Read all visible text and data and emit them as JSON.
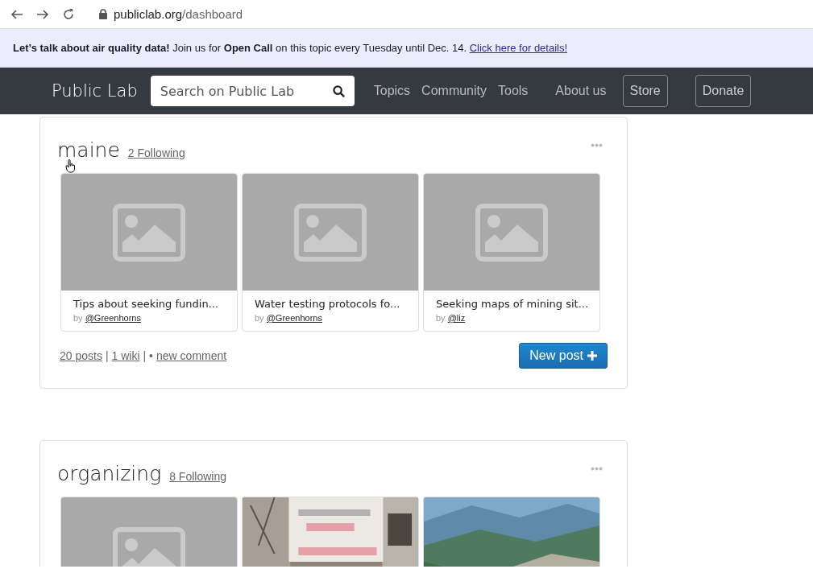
{
  "browser": {
    "url_host": "publiclab.org",
    "url_path": "/dashboard"
  },
  "banner": {
    "text": "**Let’s talk about air quality data!** Join us for **Open Call** on this topic every Tuesday until Dec. 14.",
    "link": "Click here for details!"
  },
  "navbar": {
    "logo": "Public Lab",
    "search": {
      "placeholder": "Search on Public Lab"
    },
    "links": [
      "Topics",
      "Community",
      "Tools",
      "About us"
    ],
    "buttons": [
      "Store",
      "Donate"
    ]
  },
  "topics": [
    {
      "name": "maine",
      "following": "2 Following",
      "posts": [
        {
          "kind": "placeholder",
          "title": "Tips about seeking fundin...",
          "by": "by",
          "author": "@Greenhorns"
        },
        {
          "kind": "placeholder",
          "title": "Water testing protocols fo...",
          "by": "by",
          "author": "@Greenhorns"
        },
        {
          "kind": "placeholder",
          "title": "Seeking maps of mining sit...",
          "by": "by",
          "author": "@liz"
        }
      ],
      "footer": {
        "posts": "20 posts",
        "separator_1": "|",
        "wiki": "1 wiki",
        "separator_2": "| •",
        "comment": "new comment"
      },
      "new_post": "New post"
    },
    {
      "name": "organizing",
      "following": "8 Following",
      "posts": [
        {
          "kind": "placeholder"
        },
        {
          "kind": "protest"
        },
        {
          "kind": "landscape"
        }
      ]
    }
  ]
}
